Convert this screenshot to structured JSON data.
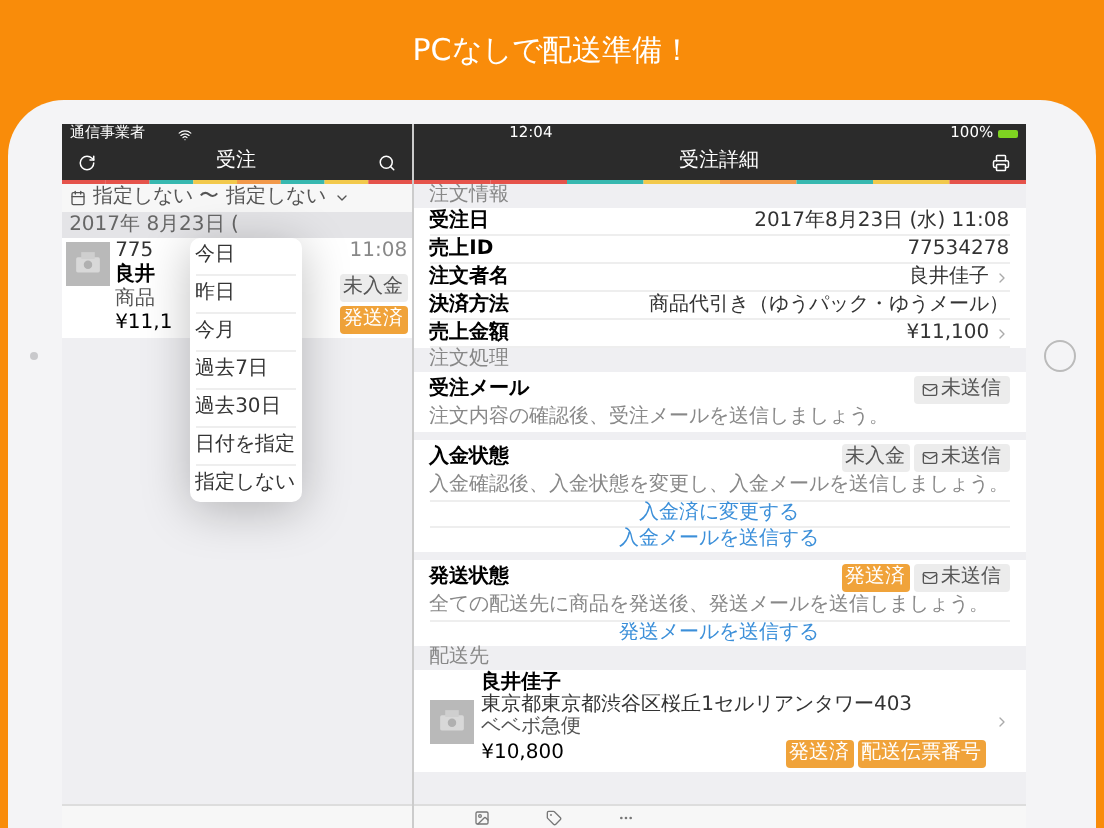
{
  "headline": "PCなしで配送準備！",
  "status_bar": {
    "carrier": "通信事業者",
    "time": "12:04",
    "battery": "100%"
  },
  "list_pane": {
    "title": "受注",
    "date_filter": "指定しない 〜 指定しない",
    "date_heading": "2017年 8月23日 (",
    "order": {
      "id": "775",
      "name": "良井",
      "method": "商品",
      "amount": "¥11,1",
      "time": "11:08",
      "badges": [
        {
          "label": "未入金",
          "kind": "plain"
        },
        {
          "label": "発送済",
          "kind": "orange"
        }
      ]
    },
    "menu": [
      "今日",
      "昨日",
      "今月",
      "過去7日",
      "過去30日",
      "日付を指定",
      "指定しない"
    ]
  },
  "detail_pane": {
    "title": "受注詳細",
    "info_label": "注文情報",
    "rows": [
      {
        "label": "受注日",
        "value": "2017年8月23日 (水) 11:08",
        "link": false
      },
      {
        "label": "売上ID",
        "value": "77534278",
        "link": false
      },
      {
        "label": "注文者名",
        "value": "良井佳子",
        "link": true
      },
      {
        "label": "決済方法",
        "value": "商品代引き（ゆうパック・ゆうメール）",
        "link": false
      },
      {
        "label": "売上金額",
        "value": "¥11,100",
        "link": true
      }
    ],
    "process_label": "注文処理",
    "cards": [
      {
        "title": "受注メール",
        "desc": "注文内容の確認後、受注メールを送信しましょう。",
        "badges": [
          {
            "label": "未送信",
            "kind": "mail"
          }
        ]
      },
      {
        "title": "入金状態",
        "desc": "入金確認後、入金状態を変更し、入金メールを送信しましょう。",
        "badges": [
          {
            "label": "未入金",
            "kind": "plain"
          },
          {
            "label": "未送信",
            "kind": "mail"
          }
        ],
        "actions": [
          "入金済に変更する",
          "入金メールを送信する"
        ]
      },
      {
        "title": "発送状態",
        "desc": "全ての配送先に商品を発送後、発送メールを送信しましょう。",
        "badges": [
          {
            "label": "発送済",
            "kind": "orange"
          },
          {
            "label": "未送信",
            "kind": "mail"
          }
        ],
        "actions": [
          "発送メールを送信する"
        ]
      }
    ],
    "shipping_label": "配送先",
    "shipping": {
      "name": "良井佳子",
      "address": "東京都東京都渋谷区桜丘1セルリアンタワー403",
      "carrier": "ベベボ急便",
      "amount": "¥10,800",
      "badges": [
        {
          "label": "発送済",
          "kind": "orange"
        },
        {
          "label": "配送伝票番号",
          "kind": "orange"
        }
      ]
    }
  }
}
